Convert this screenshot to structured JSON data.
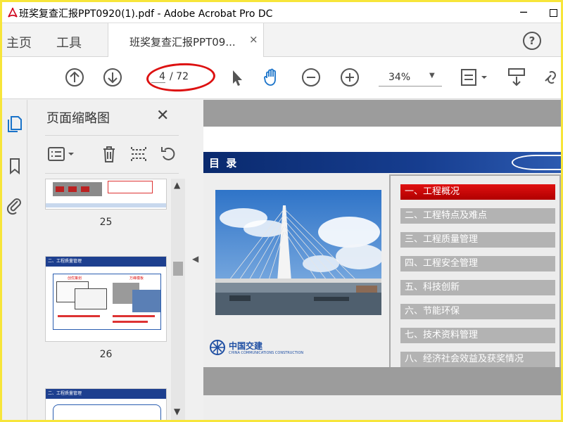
{
  "window": {
    "title": "班奖复查汇报PPT0920(1).pdf - Adobe Acrobat Pro DC",
    "minimize": "─"
  },
  "tabs": {
    "home": "主页",
    "tools": "工具",
    "document": "班奖复查汇报PPT09...",
    "close": "×",
    "help": "?"
  },
  "toolbar": {
    "current_page": "4",
    "total_pages": "/ 72",
    "zoom": "34%",
    "zoom_caret": "▼"
  },
  "thumbnails_panel": {
    "title": "页面缩略图",
    "close": "✕",
    "pages": [
      {
        "number": "25"
      },
      {
        "number": "26"
      }
    ],
    "scroll_up": "▲",
    "scroll_down": "▼"
  },
  "slide": {
    "heading": "目 录",
    "logo_name": "中国交建",
    "logo_sub": "CHINA COMMUNICATIONS CONSTRUCTION",
    "menu_items": [
      "一、工程概况",
      "二、工程特点及难点",
      "三、工程质量管理",
      "四、工程安全管理",
      "五、科技创新",
      "六、节能环保",
      "七、技术资料管理",
      "八、经济社会效益及获奖情况"
    ]
  },
  "thumb26": {
    "heading": "二、工程质量管理",
    "box1": "创优策划",
    "box2": "万峰模板"
  },
  "thumb27": {
    "heading": "二、工程质量管理"
  },
  "collapse": "◀",
  "colors": {
    "accent_red": "#d11111",
    "slide_blue": "#163d8f",
    "menu_gray": "#b3b3b3",
    "acrobat_red": "#d0021b"
  }
}
